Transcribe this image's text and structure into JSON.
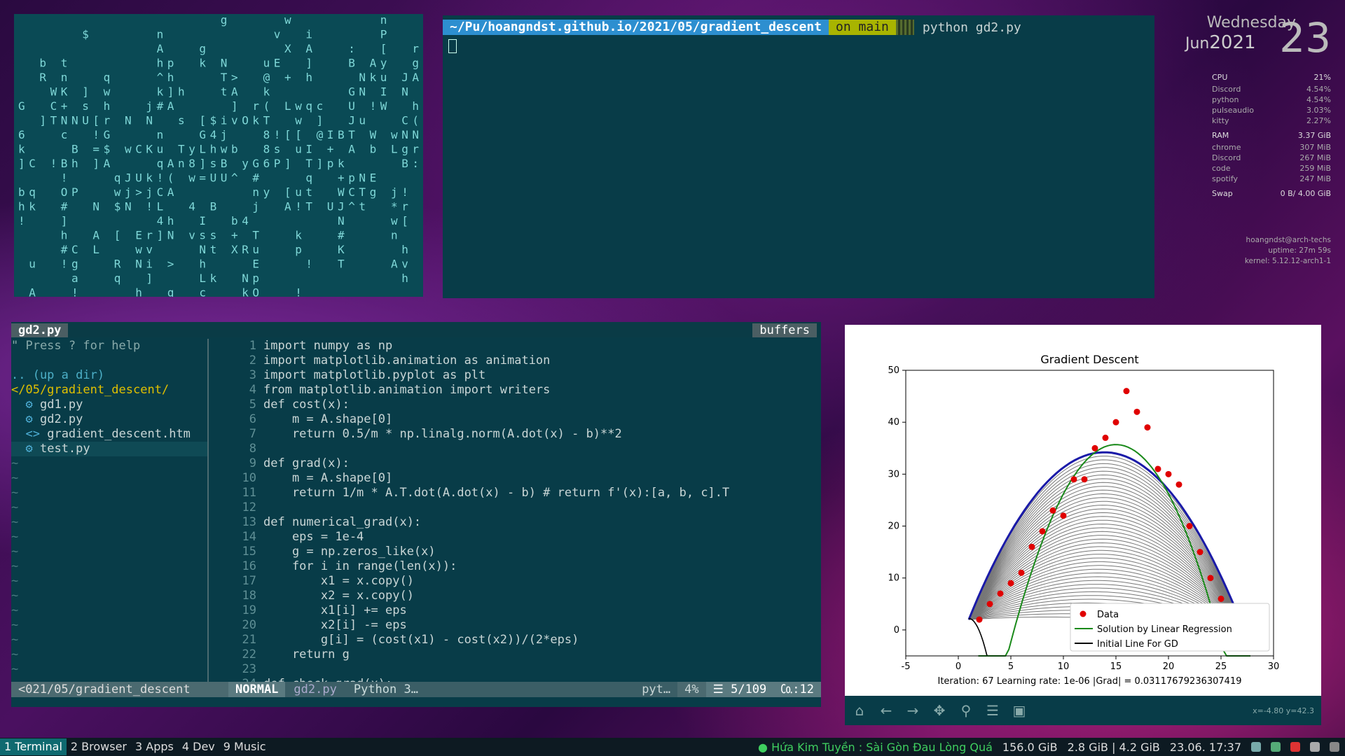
{
  "terminal": {
    "path_prefix": "~/Pu/",
    "path_bold": "hoangndst.github.io",
    "path_rest": "/2021/05/gradient_descent",
    "branch": "on main",
    "command": "python gd2.py"
  },
  "conky": {
    "day": "Wednesday",
    "month": "Jun",
    "year": "2021",
    "date": "23",
    "cpu_label": "CPU",
    "cpu_value": "21%",
    "cpu_procs": [
      {
        "name": "Discord",
        "val": "4.54%"
      },
      {
        "name": "python",
        "val": "4.54%"
      },
      {
        "name": "pulseaudio",
        "val": "3.03%"
      },
      {
        "name": "kitty",
        "val": "2.27%"
      }
    ],
    "ram_label": "RAM",
    "ram_value": "3.37 GiB",
    "ram_procs": [
      {
        "name": "chrome",
        "val": "307 MiB"
      },
      {
        "name": "Discord",
        "val": "267 MiB"
      },
      {
        "name": "code",
        "val": "259 MiB"
      },
      {
        "name": "spotify",
        "val": "247 MiB"
      }
    ],
    "swap_label": "Swap",
    "swap_value": "0 B/ 4.00 GiB",
    "user": "hoangndst@arch-techs",
    "uptime": "uptime: 27m 59s",
    "kernel": "kernel: 5.12.12-arch1-1"
  },
  "vim": {
    "tab_active": "gd2.py",
    "tab_buffers": "buffers",
    "tree": {
      "help": "\" Press ? for help",
      "up": ".. (up a dir)",
      "cwd": "</05/gradient_descent/",
      "files": [
        "gd1.py",
        "gd2.py",
        "gradient_descent.htm",
        "test.py"
      ]
    },
    "code_lines": [
      "import numpy as np",
      "import matplotlib.animation as animation",
      "import matplotlib.pyplot as plt",
      "from matplotlib.animation import writers",
      "def cost(x):",
      "    m = A.shape[0]",
      "    return 0.5/m * np.linalg.norm(A.dot(x) - b)**2",
      "",
      "def grad(x):",
      "    m = A.shape[0]",
      "    return 1/m * A.T.dot(A.dot(x) - b) # return f'(x):[a, b, c].T",
      "",
      "def numerical_grad(x):",
      "    eps = 1e-4",
      "    g = np.zeros_like(x)",
      "    for i in range(len(x)):",
      "        x1 = x.copy()",
      "        x2 = x.copy()",
      "        x1[i] += eps",
      "        x2[i] -= eps",
      "        g[i] = (cost(x1) - cost(x2))/(2*eps)",
      "    return g",
      "",
      "def check_grad(x):"
    ],
    "status": {
      "path": "<021/05/gradient_descent",
      "mode": "NORMAL",
      "file": "gd2.py",
      "type": "Python 3…",
      "ft": "pyt…",
      "percent": "4%",
      "pos": "☰ 5/109",
      "col": "㏇:12"
    }
  },
  "chart_data": {
    "type": "scatter",
    "title": "Gradient Descent",
    "xlim": [
      -5,
      30
    ],
    "ylim": [
      -5,
      50
    ],
    "xticks": [
      -5,
      0,
      5,
      10,
      15,
      20,
      25,
      30
    ],
    "yticks": [
      0,
      10,
      20,
      30,
      40,
      50
    ],
    "series": [
      {
        "name": "Data",
        "kind": "points",
        "color": "#e00000",
        "x": [
          2,
          3,
          4,
          5,
          6,
          7,
          8,
          9,
          10,
          11,
          12,
          13,
          14,
          15,
          16,
          17,
          18,
          19,
          20,
          21,
          22,
          23,
          24,
          25
        ],
        "y": [
          2,
          5,
          7,
          9,
          11,
          16,
          19,
          23,
          22,
          29,
          29,
          35,
          37,
          40,
          46,
          42,
          39,
          31,
          30,
          28,
          20,
          15,
          10,
          6
        ]
      },
      {
        "name": "Solution by Linear Regression",
        "kind": "line",
        "color": "#1a8a1a"
      },
      {
        "name": "Initial Line For GD",
        "kind": "line",
        "color": "#000000"
      }
    ],
    "footer": "Iteration: 67   Learning rate: 1e-06  |Grad| = 0.03117679236307419",
    "legend": "lower-right",
    "coord_readout": "x=-4.80 y=42.3"
  },
  "bar": {
    "workspaces": [
      {
        "label": "1 Terminal",
        "active": true
      },
      {
        "label": "2 Browser",
        "active": false
      },
      {
        "label": "3 Apps",
        "active": false
      },
      {
        "label": "4 Dev",
        "active": false
      },
      {
        "label": "9 Music",
        "active": false
      }
    ],
    "now_playing": "Hứa Kim Tuyền : Sài Gòn Đau Lòng Quá",
    "disk": "156.0 GiB",
    "mem": "2.8 GiB | 4.2 GiB",
    "clock": "23.06. 17:37"
  }
}
